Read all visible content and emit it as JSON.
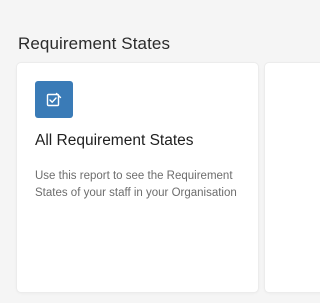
{
  "section": {
    "title": "Requirement States"
  },
  "cards": [
    {
      "icon": "edit-checklist-icon",
      "title": "All Requirement States",
      "description": "Use this report to see the Requirement States of your staff in your Organisation"
    }
  ],
  "colors": {
    "icon_tile": "#3a7bb7",
    "page_bg": "#f5f5f5",
    "card_bg": "#ffffff"
  }
}
